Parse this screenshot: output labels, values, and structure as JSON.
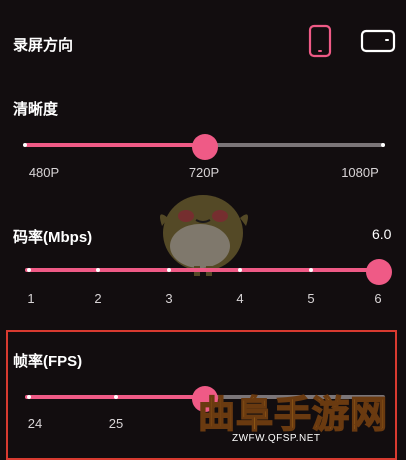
{
  "orientation": {
    "label": "录屏方向",
    "options": [
      {
        "icon": "portrait-phone-icon",
        "selected": true
      },
      {
        "icon": "landscape-phone-icon",
        "selected": false
      }
    ]
  },
  "resolution": {
    "label": "清晰度",
    "ticks": [
      "480P",
      "720P",
      "1080P"
    ],
    "selected": "720P"
  },
  "bitrate": {
    "label": "码率(Mbps)",
    "current_value": "6.0",
    "ticks": [
      "1",
      "2",
      "3",
      "4",
      "5",
      "6"
    ],
    "selected": "6"
  },
  "framerate": {
    "label": "帧率(FPS)",
    "ticks": [
      "24",
      "25"
    ],
    "selected_fraction": 0.5
  },
  "watermark": {
    "text": "曲阜手游网",
    "url": "ZWFW.QFSP.NET"
  },
  "colors": {
    "accent": "#ef5a86",
    "track": "#7b7578",
    "background": "#120d0f",
    "highlight_border": "#d83a30"
  }
}
